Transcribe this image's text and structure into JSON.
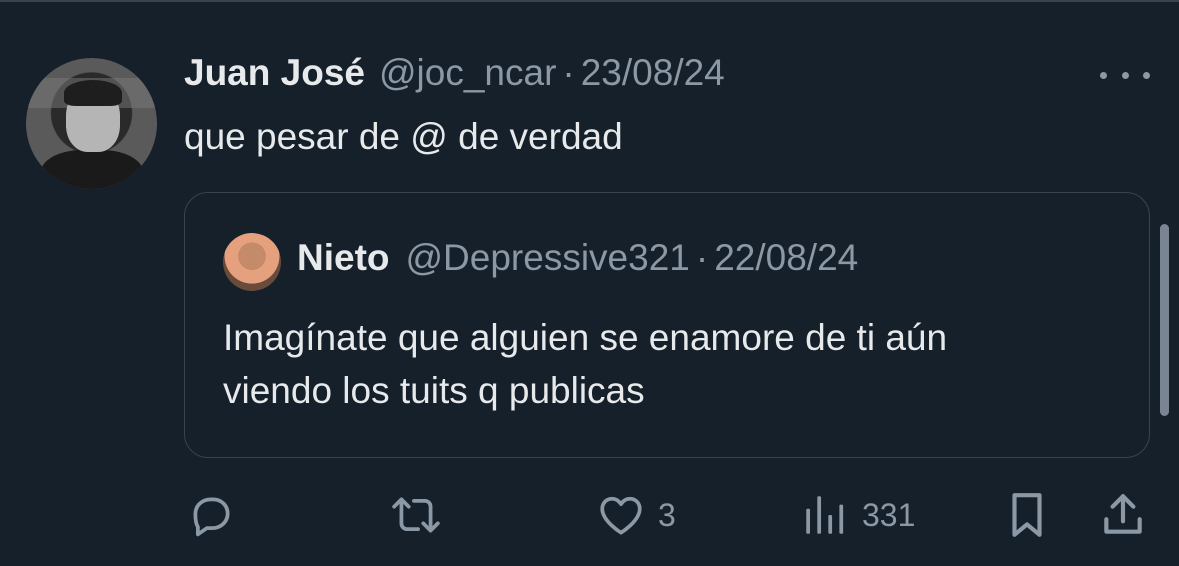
{
  "tweet": {
    "author_name": "Juan José",
    "author_handle": "@joc_ncar",
    "separator": "·",
    "date": "23/08/24",
    "text": "que pesar de @ de verdad",
    "quoted": {
      "author_name": "Nieto",
      "author_handle": "@Depressive321",
      "separator": "·",
      "date": "22/08/24",
      "text_line1": "Imagínate que alguien se enamore de ti aún",
      "text_line2": "viendo los tuits q publicas"
    }
  },
  "actions": {
    "reply_icon": "reply-icon",
    "retweet_icon": "retweet-icon",
    "like_icon": "heart-icon",
    "like_count": "3",
    "views_icon": "views-icon",
    "views_count": "331",
    "bookmark_icon": "bookmark-icon",
    "share_icon": "share-icon"
  },
  "colors": {
    "background": "#15202b",
    "primary_text": "#e7e9ea",
    "secondary_text": "#8b98a5",
    "border": "#38444d"
  }
}
